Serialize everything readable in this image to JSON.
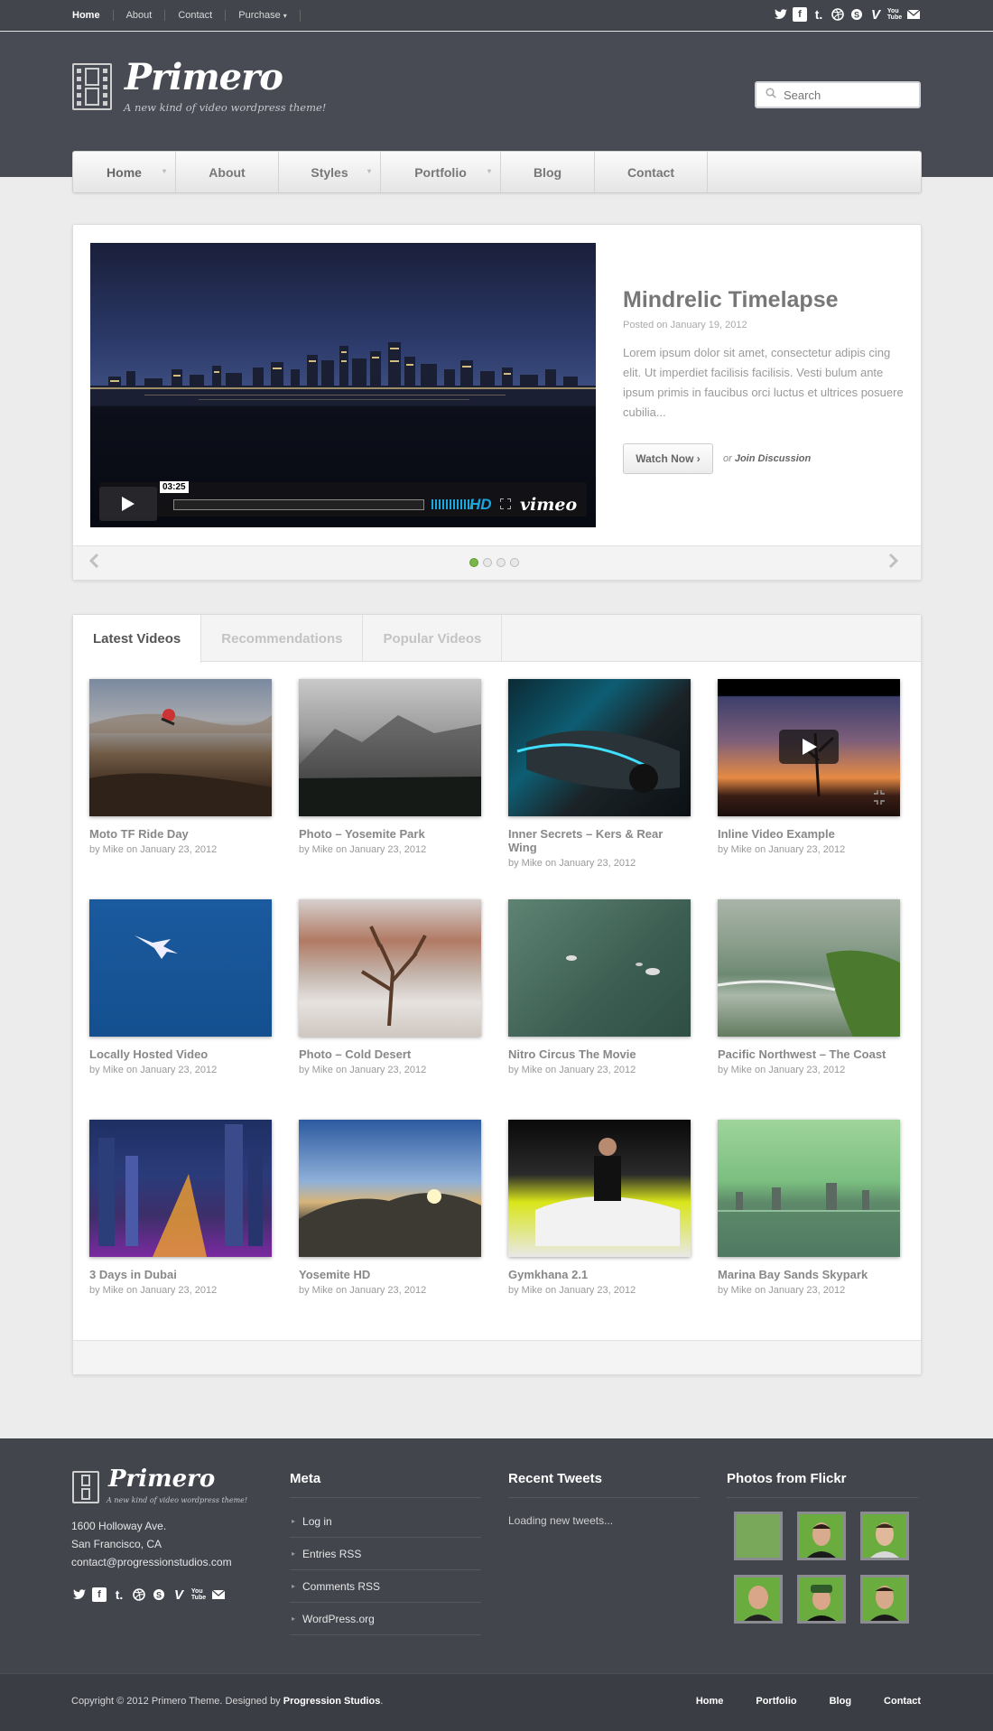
{
  "topbar": {
    "links": [
      "Home",
      "About",
      "Contact",
      "Purchase"
    ],
    "purchase_caret": "▾",
    "social_icons": [
      "twitter-icon",
      "facebook-icon",
      "tumblr-icon",
      "dribbble-icon",
      "skype-icon",
      "vimeo-icon",
      "youtube-icon",
      "email-icon"
    ]
  },
  "header": {
    "logo_text": "Primero",
    "tagline": "A new kind of video wordpress theme!",
    "search_placeholder": "Search"
  },
  "nav": {
    "items": [
      {
        "label": "Home",
        "dropdown": true
      },
      {
        "label": "About",
        "dropdown": false
      },
      {
        "label": "Styles",
        "dropdown": true
      },
      {
        "label": "Portfolio",
        "dropdown": true
      },
      {
        "label": "Blog",
        "dropdown": false
      },
      {
        "label": "Contact",
        "dropdown": false
      }
    ]
  },
  "slider": {
    "title": "Mindrelic Timelapse",
    "date": "Posted on January 19, 2012",
    "description": "Lorem ipsum dolor sit amet, consectetur adipis cing elit. Ut imperdiet facilisis facilisis. Vesti bulum ante ipsum primis in faucibus orci luctus et ultrices posuere cubilia...",
    "watch_label": "Watch Now ›",
    "or_label": "or",
    "join_label": "Join Discussion",
    "player": {
      "timecode": "03:25",
      "hd": "HD",
      "brand": "vimeo"
    },
    "active_slide": 1,
    "slide_count": 4
  },
  "videos": {
    "tabs": [
      "Latest Videos",
      "Recommendations",
      "Popular Videos"
    ],
    "active_tab": 0,
    "items": [
      {
        "title": "Moto TF Ride Day",
        "meta": "by Mike on January 23, 2012"
      },
      {
        "title": "Photo – Yosemite Park",
        "meta": "by Mike on January 23, 2012"
      },
      {
        "title": "Inner Secrets – Kers & Rear Wing",
        "meta": "by Mike on January 23, 2012"
      },
      {
        "title": "Inline Video Example",
        "meta": "by Mike on January 23, 2012"
      },
      {
        "title": "Locally Hosted Video",
        "meta": "by Mike on January 23, 2012"
      },
      {
        "title": "Photo – Cold Desert",
        "meta": "by Mike on January 23, 2012"
      },
      {
        "title": "Nitro Circus The Movie",
        "meta": "by Mike on January 23, 2012"
      },
      {
        "title": "Pacific Northwest – The Coast",
        "meta": "by Mike on January 23, 2012"
      },
      {
        "title": "3 Days in Dubai",
        "meta": "by Mike on January 23, 2012"
      },
      {
        "title": "Yosemite HD",
        "meta": "by Mike on January 23, 2012"
      },
      {
        "title": "Gymkhana 2.1",
        "meta": "by Mike on January 23, 2012"
      },
      {
        "title": "Marina Bay Sands Skypark",
        "meta": "by Mike on January 23, 2012"
      }
    ]
  },
  "footer": {
    "logo_text": "Primero",
    "tagline": "A new kind of video wordpress theme!",
    "address": [
      "1600 Holloway Ave.",
      "San Francisco, CA",
      "contact@progressionstudios.com"
    ],
    "meta_title": "Meta",
    "meta_links": [
      "Log in",
      "Entries RSS",
      "Comments RSS",
      "WordPress.org"
    ],
    "tweets_title": "Recent Tweets",
    "tweets_text": "Loading new tweets...",
    "flickr_title": "Photos from Flickr",
    "copyright_prefix": "Copyright © 2012 Primero Theme. Designed by",
    "copyright_link": "Progression Studios",
    "copyright_suffix": ".",
    "bottom_links": [
      "Home",
      "Portfolio",
      "Blog",
      "Contact"
    ]
  }
}
